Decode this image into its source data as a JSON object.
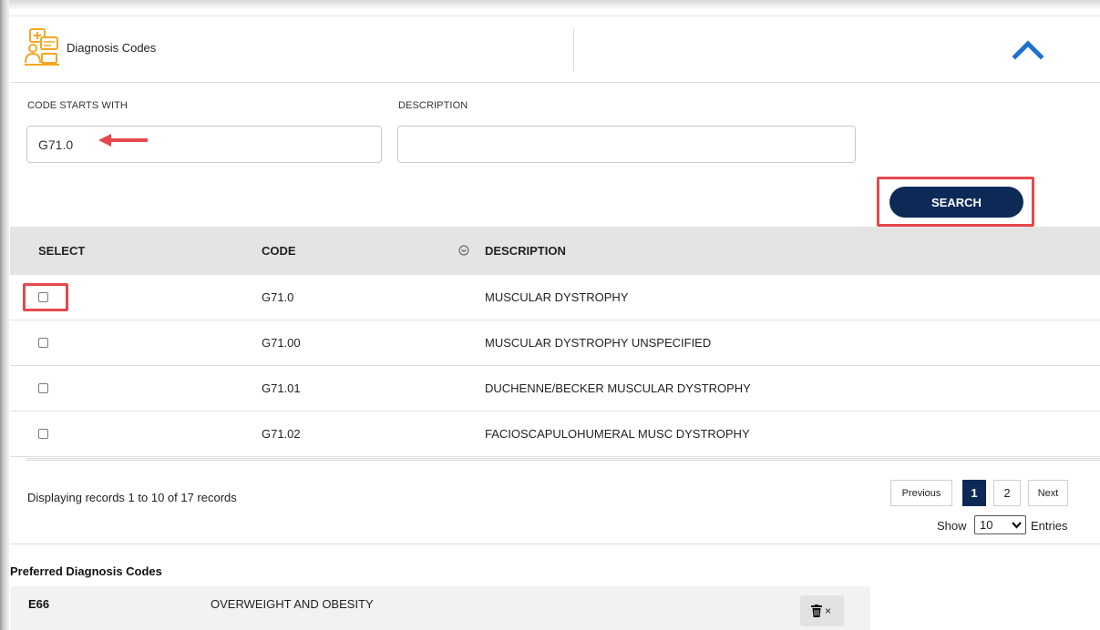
{
  "header": {
    "title": "Diagnosis Codes"
  },
  "search_form": {
    "code_label": "CODE STARTS WITH",
    "code_value": "G71.0",
    "description_label": "DESCRIPTION",
    "description_value": "",
    "search_label": "SEARCH"
  },
  "table": {
    "columns": [
      "SELECT",
      "CODE",
      "DESCRIPTION"
    ],
    "rows": [
      {
        "code": "G71.0",
        "description": "MUSCULAR DYSTROPHY",
        "checked": false
      },
      {
        "code": "G71.00",
        "description": "MUSCULAR DYSTROPHY UNSPECIFIED",
        "checked": false
      },
      {
        "code": "G71.01",
        "description": "DUCHENNE/BECKER MUSCULAR DYSTROPHY",
        "checked": false
      },
      {
        "code": "G71.02",
        "description": "FACIOSCAPULOHUMERAL MUSC DYSTROPHY",
        "checked": false
      }
    ]
  },
  "pagination": {
    "records_text": "Displaying records 1 to 10 of 17 records",
    "previous_label": "Previous",
    "pages": [
      "1",
      "2"
    ],
    "current_page": "1",
    "next_label": "Next",
    "show_label": "Show",
    "entries_value": "10",
    "entries_label": "Entries"
  },
  "preferred": {
    "title": "Preferred Diagnosis Codes",
    "items": [
      {
        "code": "E66",
        "description": "OVERWEIGHT AND OBESITY",
        "remove_glyph": "×"
      }
    ]
  },
  "icons": {
    "header": "medical-records-icon",
    "collapse": "chevron-up-icon",
    "sort": "sort-circle-icon",
    "delete": "trash-icon",
    "annotation": "red-arrow-icon"
  },
  "colors": {
    "primary": "#0d2a57",
    "collapse_chevron": "#1f6fd1",
    "icon_accent": "#f5a623",
    "highlight": "#e5484d",
    "table_header_bg": "#e4e4e4"
  }
}
